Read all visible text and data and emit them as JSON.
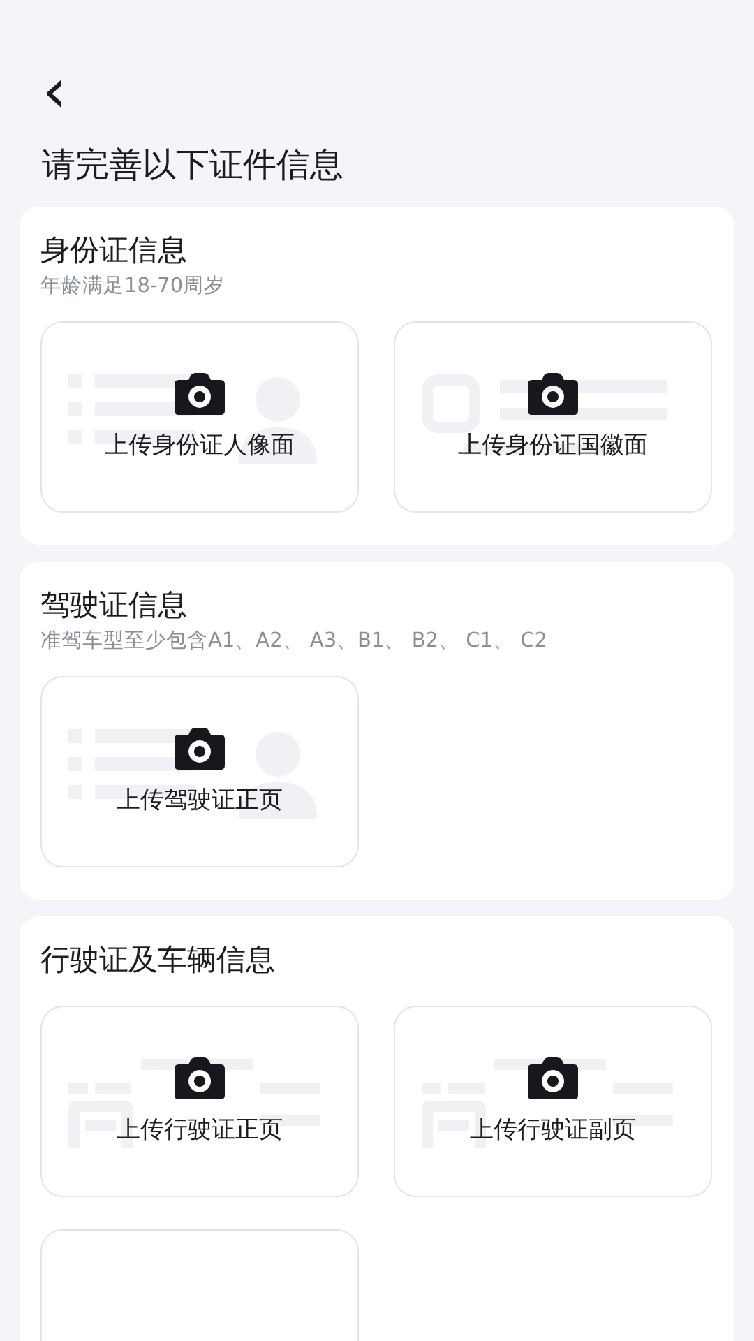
{
  "header": {
    "back": "‹",
    "title": "请完善以下证件信息"
  },
  "sections": [
    {
      "title": "身份证信息",
      "subtitle": "年龄满足18-70周岁",
      "tiles": [
        {
          "kind": "id-front",
          "label": "上传身份证人像面"
        },
        {
          "kind": "id-back",
          "label": "上传身份证国徽面"
        }
      ]
    },
    {
      "title": "驾驶证信息",
      "subtitle": "准驾车型至少包含A1、A2、 A3、B1、 B2、 C1、 C2",
      "tiles": [
        {
          "kind": "id-front",
          "label": "上传驾驶证正页"
        }
      ]
    },
    {
      "title": "行驶证及车辆信息",
      "tiles": [
        {
          "kind": "vehicle",
          "label": "上传行驶证正页"
        },
        {
          "kind": "vehicle",
          "label": "上传行驶证副页"
        },
        {
          "kind": "blank"
        }
      ]
    }
  ]
}
